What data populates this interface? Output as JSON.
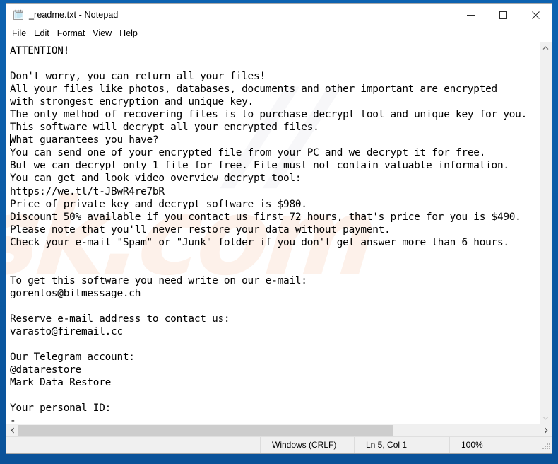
{
  "window": {
    "title": "_readme.txt - Notepad",
    "icon": "notepad-icon",
    "controls": {
      "minimize": "minimize-icon",
      "maximize": "maximize-icon",
      "close": "close-icon"
    }
  },
  "menu": {
    "items": [
      {
        "label": "File"
      },
      {
        "label": "Edit"
      },
      {
        "label": "Format"
      },
      {
        "label": "View"
      },
      {
        "label": "Help"
      }
    ]
  },
  "editor": {
    "content": "ATTENTION!\n\nDon't worry, you can return all your files!\nAll your files like photos, databases, documents and other important are encrypted\nwith strongest encryption and unique key.\nThe only method of recovering files is to purchase decrypt tool and unique key for you.\nThis software will decrypt all your encrypted files.\nWhat guarantees you have?\nYou can send one of your encrypted file from your PC and we decrypt it for free.\nBut we can decrypt only 1 file for free. File must not contain valuable information.\nYou can get and look video overview decrypt tool:\nhttps://we.tl/t-JBwR4re7bR\nPrice of private key and decrypt software is $980.\nDiscount 50% available if you contact us first 72 hours, that's price for you is $490.\nPlease note that you'll never restore your data without payment.\nCheck your e-mail \"Spam\" or \"Junk\" folder if you don't get answer more than 6 hours.\n\n\nTo get this software you need write on our e-mail:\ngorentos@bitmessage.ch\n\nReserve e-mail address to contact us:\nvarasto@firemail.cc\n\nOur Telegram account:\n@datarestore\nMark Data Restore\n\nYour personal ID:\n-",
    "watermark_primary": "sk.com",
    "watermark_secondary": "//"
  },
  "scrollbars": {
    "vertical_up": "chevron-up-icon",
    "vertical_down": "chevron-down-icon",
    "horizontal_left": "chevron-left-icon",
    "horizontal_right": "chevron-right-icon"
  },
  "status_bar": {
    "line_ending": "Windows (CRLF)",
    "cursor_position": "Ln 5, Col 1",
    "zoom": "100%"
  },
  "colors": {
    "desktop": "#0b5aa4",
    "window_bg": "#ffffff",
    "chrome_bg": "#f0f0f0",
    "scroll_thumb": "#cdcdcd",
    "text": "#000000"
  }
}
